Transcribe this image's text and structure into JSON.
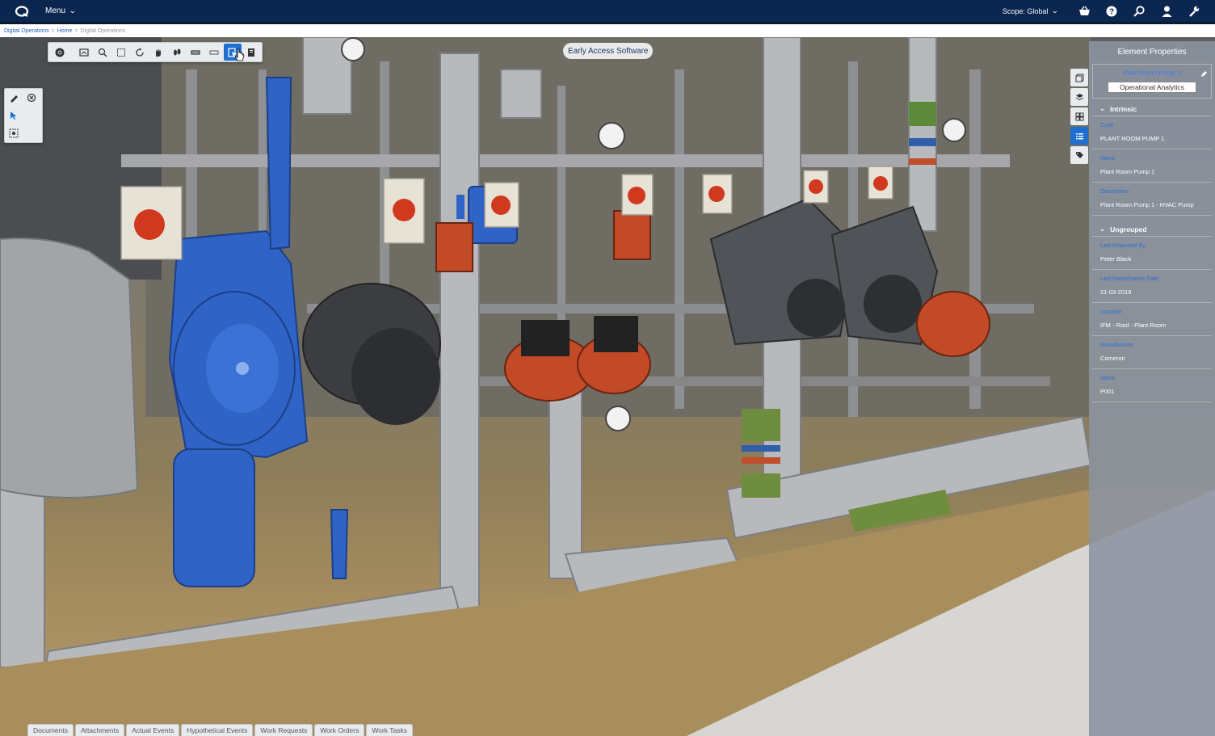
{
  "topbar": {
    "menu_label": "Menu",
    "scope_label": "Scope: Global",
    "icons": [
      "basket-icon",
      "help-icon",
      "search-icon",
      "user-icon",
      "wrench-icon"
    ]
  },
  "breadcrumb": {
    "items": [
      "Digital Operations",
      "Home",
      "Digital Operations"
    ],
    "separator": ">"
  },
  "viewer": {
    "badge": "Early Access Software",
    "toolbar_icons": [
      "settings-icon",
      "fit-view-icon",
      "zoom-icon",
      "frame-icon",
      "rotate-icon",
      "pan-icon",
      "walk-icon",
      "section-icon",
      "section-alt-icon",
      "select-object-icon",
      "layers-icon"
    ],
    "active_tool": "select-object-icon",
    "side_icons": [
      "measure-icon",
      "clear-icon",
      "pointer-icon",
      "zoom-box-icon"
    ],
    "right_icons": [
      "cube-icon",
      "layers-icon",
      "grid-icon",
      "list-icon",
      "tag-icon"
    ]
  },
  "properties": {
    "title": "Element Properties",
    "element_name": "Plant Room Pump 1",
    "action_button": "Operational Analytics",
    "sections": [
      {
        "title": "Intrinsic",
        "fields": [
          {
            "label": "Code",
            "value": "PLANT ROOM PUMP 1"
          },
          {
            "label": "Name",
            "value": "Plant Room Pump 1"
          },
          {
            "label": "Description",
            "value": "Plant Room Pump 1 - HVAC Pump"
          }
        ]
      },
      {
        "title": "Ungrouped",
        "fields": [
          {
            "label": "Last Inspected By",
            "value": "Peter Black"
          },
          {
            "label": "Last Maintenance Date",
            "value": "21-03-2019"
          },
          {
            "label": "Location",
            "value": "IFM - Roof - Plant Room"
          },
          {
            "label": "Manufacturer",
            "value": "Cameron"
          },
          {
            "label": "Name",
            "value": "P001"
          }
        ]
      }
    ]
  },
  "bottom_tabs": [
    "Documents",
    "Attachments",
    "Actual Events",
    "Hypothetical Events",
    "Work Requests",
    "Work Orders",
    "Work Tasks"
  ],
  "colors": {
    "topbar": "#0b2750",
    "accent": "#1f6fd0",
    "link": "#2a62b7",
    "highlight_pump": "#2f63c6"
  }
}
